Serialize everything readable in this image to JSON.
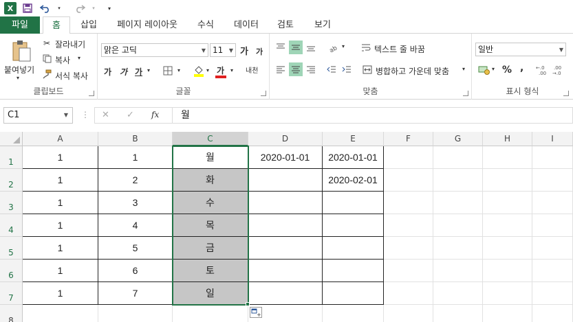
{
  "qat": {
    "logo": "X",
    "save_icon": "save-icon",
    "undo_icon": "undo-icon",
    "redo_icon": "redo-icon"
  },
  "tabs": [
    "파일",
    "홈",
    "삽입",
    "페이지 레이아웃",
    "수식",
    "데이터",
    "검토",
    "보기"
  ],
  "active_tab": "홈",
  "ribbon": {
    "clipboard": {
      "label": "클립보드",
      "paste": "붙여넣기",
      "cut": "잘라내기",
      "copy": "복사",
      "format_painter": "서식 복사"
    },
    "font": {
      "label": "글꼴",
      "font_name": "맑은 고딕",
      "font_size": "11",
      "grow": "가",
      "shrink": "가",
      "bold": "가",
      "italic": "가",
      "underline": "가",
      "font_color_glyph": "가",
      "phonetic": "내천"
    },
    "alignment": {
      "label": "맞춤",
      "wrap_text": "텍스트 줄 바꿈",
      "merge_center": "병합하고 가운데 맞춤"
    },
    "number": {
      "label": "표시 형식",
      "format": "일반",
      "percent": "%",
      "comma": ","
    }
  },
  "formula_bar": {
    "name_box": "C1",
    "fx": "fx",
    "content": "월"
  },
  "columns": [
    "A",
    "B",
    "C",
    "D",
    "E",
    "F",
    "G",
    "H",
    "I"
  ],
  "selected_column": "C",
  "rows": [
    {
      "num": "1",
      "A": "1",
      "B": "1",
      "C": "월",
      "D": "2020-01-01",
      "E": "2020-01-01"
    },
    {
      "num": "2",
      "A": "1",
      "B": "2",
      "C": "화",
      "D": "",
      "E": "2020-02-01"
    },
    {
      "num": "3",
      "A": "1",
      "B": "3",
      "C": "수",
      "D": "",
      "E": ""
    },
    {
      "num": "4",
      "A": "1",
      "B": "4",
      "C": "목",
      "D": "",
      "E": ""
    },
    {
      "num": "5",
      "A": "1",
      "B": "5",
      "C": "금",
      "D": "",
      "E": ""
    },
    {
      "num": "6",
      "A": "1",
      "B": "6",
      "C": "토",
      "D": "",
      "E": ""
    },
    {
      "num": "7",
      "A": "1",
      "B": "7",
      "C": "일",
      "D": "",
      "E": ""
    },
    {
      "num": "8"
    }
  ]
}
